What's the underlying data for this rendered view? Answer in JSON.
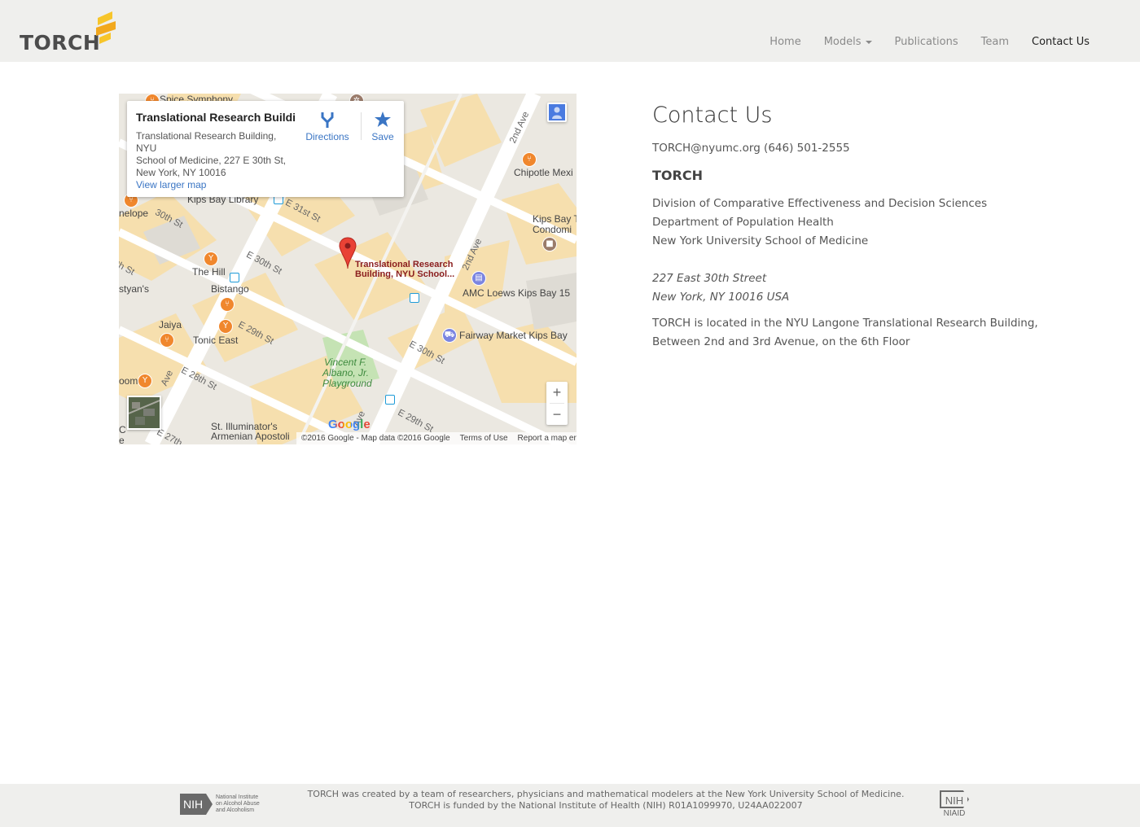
{
  "header": {
    "logo": "TORCH",
    "nav": [
      {
        "label": "Home",
        "active": false
      },
      {
        "label": "Models",
        "active": false,
        "dropdown": true
      },
      {
        "label": "Publications",
        "active": false
      },
      {
        "label": "Team",
        "active": false
      },
      {
        "label": "Contact Us",
        "active": true
      }
    ],
    "colors": {
      "background": "#efefed",
      "logo_accent": "#f7c52a",
      "nav_text": "#8a8a8a"
    }
  },
  "map": {
    "info_card": {
      "title": "Translational Research Buildi...",
      "address_line1": "Translational Research Building, NYU",
      "address_line2": "School of Medicine, 227 E 30th St,",
      "address_line3": "New York, NY 10016",
      "directions": "Directions",
      "save": "Save",
      "view_larger": "View larger map"
    },
    "pin_label_line1": "Translational Research",
    "pin_label_line2": "Building, NYU School...",
    "labels": {
      "spice": "Spice Symphony",
      "kips_library": "Kips Bay Library",
      "penelope": "nelope",
      "e30_left": "30th St",
      "e31": "E 31st St",
      "th_st": "th St",
      "the_hill": "The Hill",
      "bistango": "Bistango",
      "styans": "styan's",
      "jaiya": "Jaiya",
      "tonic": "Tonic East",
      "e30": "E 30th St",
      "e29": "E 29th St",
      "e28": "E 28th St",
      "e27": "E 27th",
      "boom": "oom",
      "ave": "Ave",
      "second_ave_top": "2nd Ave",
      "second_ave_mid": "2nd Ave",
      "chipotle": "Chipotle Mexi",
      "kips_condo1": "Kips Bay T",
      "kips_condo2": "Condomi",
      "amc": "AMC Loews Kips Bay 15",
      "fairway": "Fairway Market Kips Bay",
      "e30_right": "E 30th St",
      "e29_right": "E 29th St",
      "park1": "Vincent F.",
      "park2": "Albano, Jr.",
      "park3": "Playground",
      "illuminator1": "St. Illuminator's",
      "illuminator2": "Armenian Apostoli",
      "c_left": "C",
      "e_left": "e"
    },
    "google": "Google",
    "footer": {
      "copyright": "©2016 Google - Map data ©2016 Google",
      "terms": "Terms of Use",
      "report": "Report a map error"
    },
    "zoom_in": "+",
    "zoom_out": "−"
  },
  "contact": {
    "title": "Contact Us",
    "email_phone": "TORCH@nyumc.org (646) 501-2555",
    "org": "TORCH",
    "division": "Division of Comparative Effectiveness and Decision Sciences",
    "department": "Department of Population Health",
    "school": "New York University School of Medicine",
    "street": "227 East 30th Street",
    "city": "New York, NY  10016 USA",
    "location_line1": "TORCH is located in the NYU Langone Translational Research Building,",
    "location_line2": "Between 2nd and 3rd Avenue, on the 6th Floor"
  },
  "footer": {
    "line1": "TORCH was created by a team of researchers, physicians and mathematical modelers at the New York University School of Medicine.",
    "line2": "TORCH is funded by the National Institute of Health (NIH) R01A1099970, U24AA022007",
    "nih_left_badge": "NIH",
    "nih_left_text": "National Institute on Alcohol Abuse and Alcoholism",
    "nih_right_badge": "NIH",
    "nih_right_label": "NIAID"
  }
}
